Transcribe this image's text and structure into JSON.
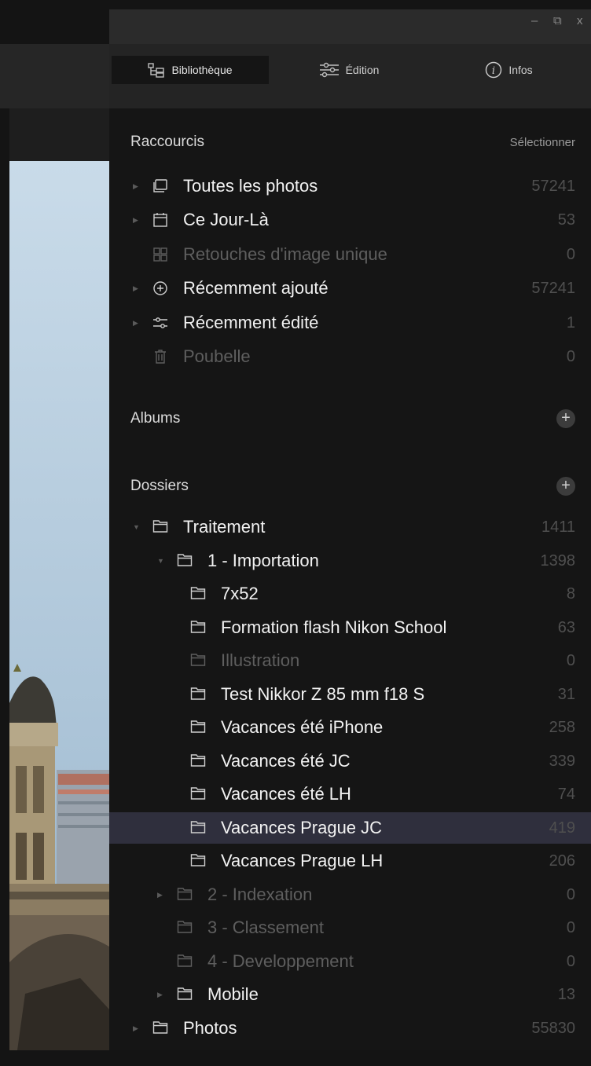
{
  "window": {
    "minimize_glyph": "–",
    "restore_glyph": "⧉",
    "close_glyph": "x"
  },
  "tabs": [
    {
      "label": "Bibliothèque",
      "icon": "library-icon",
      "active": true
    },
    {
      "label": "Édition",
      "icon": "sliders-icon",
      "active": false
    },
    {
      "label": "Infos",
      "icon": "info-icon",
      "active": false
    }
  ],
  "shortcuts": {
    "title": "Raccourcis",
    "action": "Sélectionner",
    "items": [
      {
        "label": "Toutes les photos",
        "count": "57241",
        "icon": "photos-icon",
        "dim": false
      },
      {
        "label": "Ce Jour-Là",
        "count": "53",
        "icon": "calendar-icon",
        "dim": false
      },
      {
        "label": "Retouches d'image unique",
        "count": "0",
        "icon": "grid-icon",
        "dim": true
      },
      {
        "label": "Récemment ajouté",
        "count": "57241",
        "icon": "add-circle-icon",
        "dim": false
      },
      {
        "label": "Récemment édité",
        "count": "1",
        "icon": "sliders-icon",
        "dim": false
      },
      {
        "label": "Poubelle",
        "count": "0",
        "icon": "trash-icon",
        "dim": true
      }
    ]
  },
  "albums": {
    "title": "Albums",
    "add": "+"
  },
  "folders": {
    "title": "Dossiers",
    "add": "+",
    "items": [
      {
        "label": "Traitement",
        "count": "1411",
        "level": 0,
        "expander": "open"
      },
      {
        "label": "1 - Importation",
        "count": "1398",
        "level": 1,
        "expander": "open"
      },
      {
        "label": "7x52",
        "count": "8",
        "level": 2,
        "expander": "none"
      },
      {
        "label": "Formation flash Nikon School",
        "count": "63",
        "level": 2,
        "expander": "none"
      },
      {
        "label": "Illustration",
        "count": "0",
        "level": 2,
        "expander": "none",
        "dim": true
      },
      {
        "label": "Test Nikkor Z 85 mm f18 S",
        "count": "31",
        "level": 2,
        "expander": "none"
      },
      {
        "label": "Vacances été iPhone",
        "count": "258",
        "level": 2,
        "expander": "none"
      },
      {
        "label": "Vacances été JC",
        "count": "339",
        "level": 2,
        "expander": "none"
      },
      {
        "label": "Vacances été LH",
        "count": "74",
        "level": 2,
        "expander": "none"
      },
      {
        "label": "Vacances Prague JC",
        "count": "419",
        "level": 2,
        "expander": "none",
        "selected": true
      },
      {
        "label": "Vacances Prague LH",
        "count": "206",
        "level": 2,
        "expander": "none"
      },
      {
        "label": "2 - Indexation",
        "count": "0",
        "level": 1,
        "expander": "closed",
        "dim": true
      },
      {
        "label": "3 - Classement",
        "count": "0",
        "level": 1,
        "expander": "none",
        "dim": true
      },
      {
        "label": "4 - Developpement",
        "count": "0",
        "level": 1,
        "expander": "none",
        "dim": true
      },
      {
        "label": "Mobile",
        "count": "13",
        "level": 1,
        "expander": "closed"
      },
      {
        "label": "Photos",
        "count": "55830",
        "level": 0,
        "expander": "closed"
      }
    ]
  },
  "colors": {
    "selected_row": "#2f2f3d",
    "panel_bg": "#151515",
    "tabbar_bg": "#242424"
  }
}
